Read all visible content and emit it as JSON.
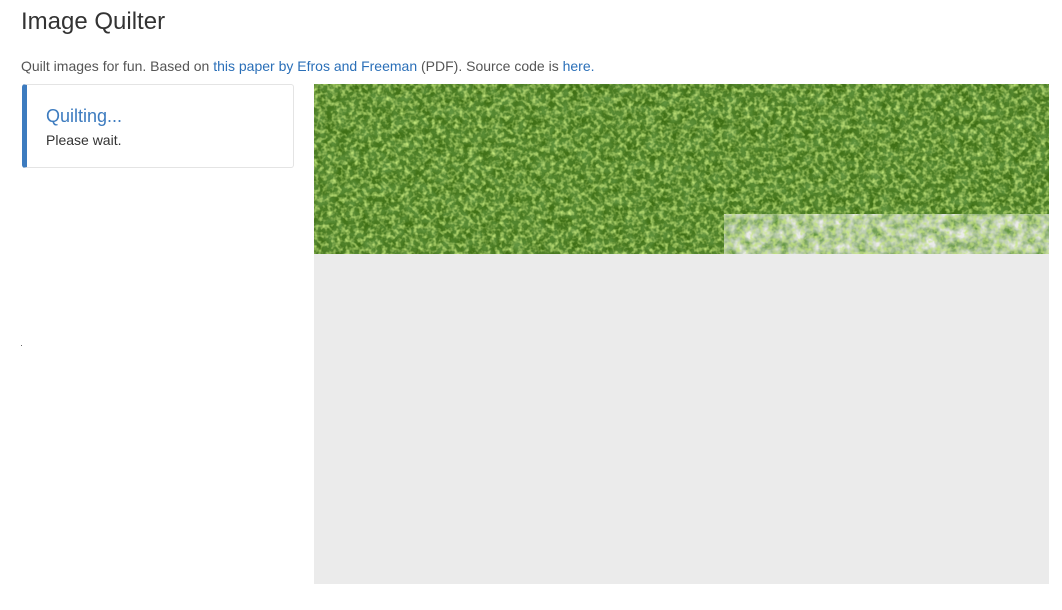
{
  "header": {
    "title": "Image Quilter"
  },
  "intro": {
    "prefix": "Quilt images for fun. Based on ",
    "paper_link": "this paper by Efros and Freeman",
    "middle": " (PDF). Source code is ",
    "source_link": "here."
  },
  "status": {
    "title": "Quilting...",
    "message": "Please wait."
  },
  "quilt": {
    "progress_description": "partially filled texture",
    "colors": {
      "moss_dark": "#2d4a10",
      "moss_mid": "#4f8a1c",
      "moss_light": "#8cc63f",
      "unfilled": "#ebebeb"
    }
  }
}
